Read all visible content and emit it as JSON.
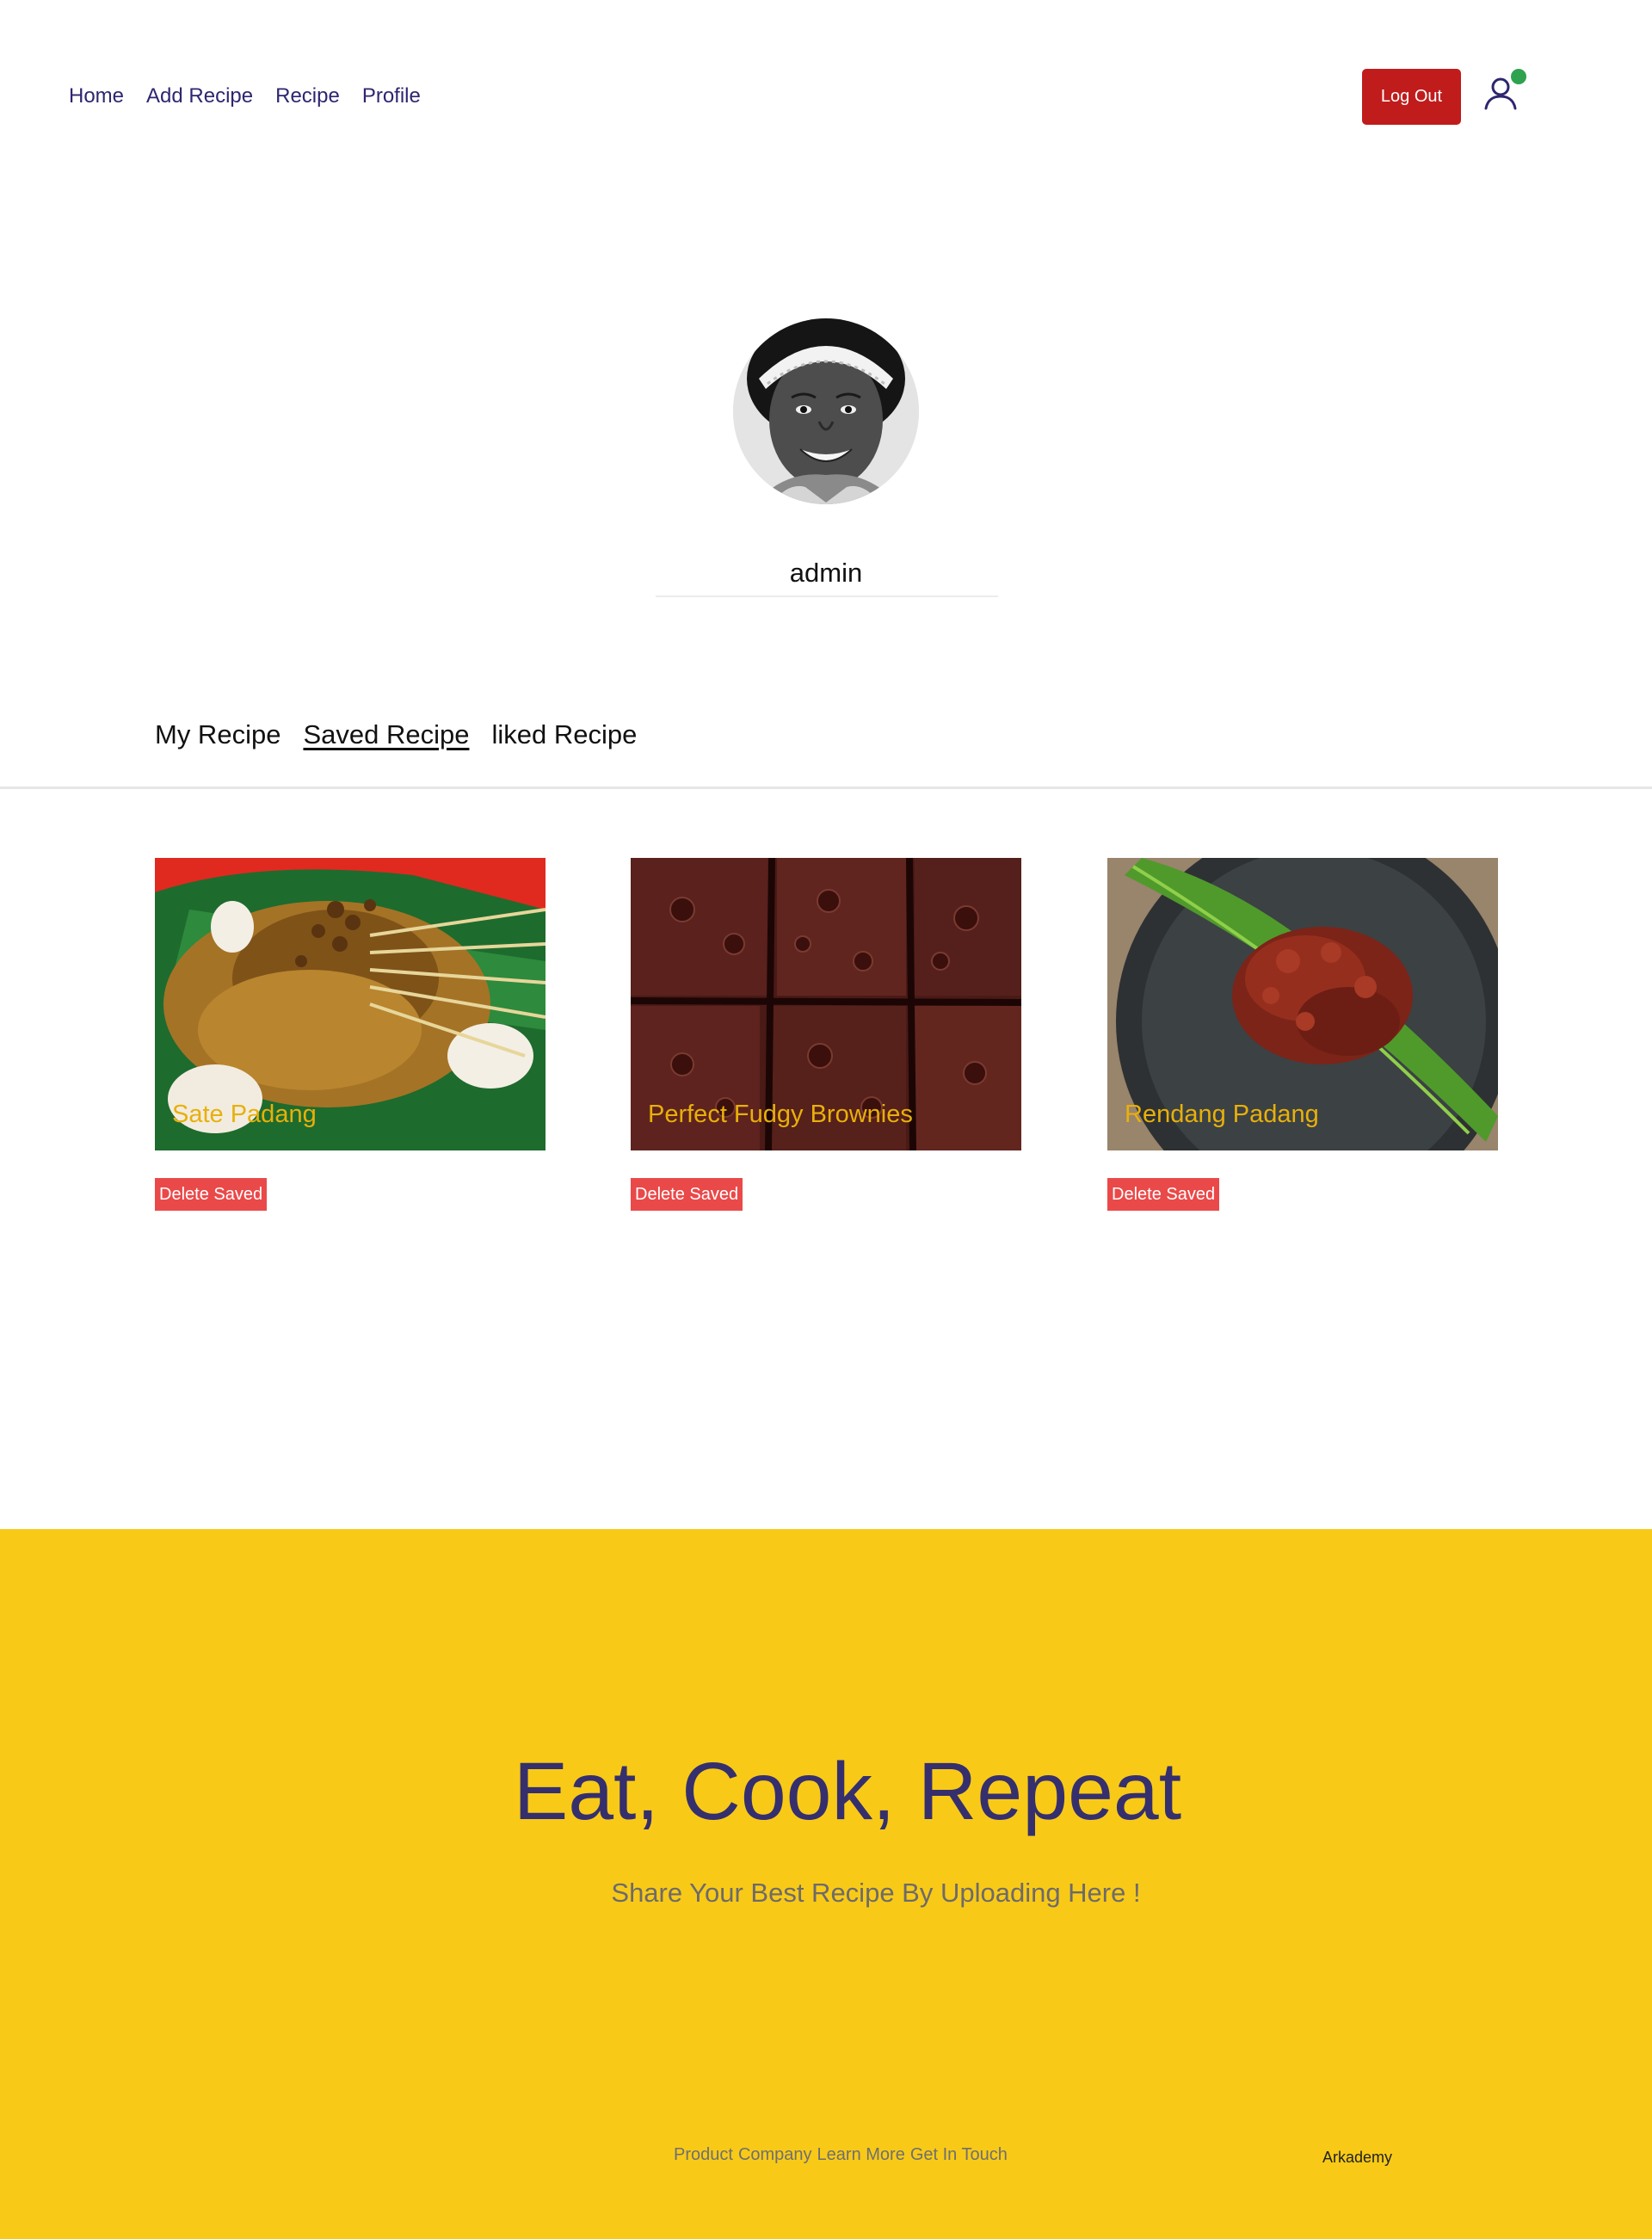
{
  "nav": {
    "links": [
      "Home",
      "Add Recipe",
      "Recipe",
      "Profile"
    ],
    "logout_label": "Log Out",
    "user_icon": "user-icon",
    "status_color": "#2ea24f"
  },
  "profile": {
    "username": "admin",
    "avatar": "profile-avatar-photo"
  },
  "tabs": {
    "items": [
      "My Recipe",
      "Saved Recipe",
      "liked Recipe"
    ],
    "active": "Saved Recipe"
  },
  "recipes": [
    {
      "title": "Sate Padang",
      "delete_label": "Delete Saved"
    },
    {
      "title": "Perfect Fudgy Brownies",
      "delete_label": "Delete Saved"
    },
    {
      "title": "Rendang Padang",
      "delete_label": "Delete Saved"
    }
  ],
  "footer": {
    "heading": "Eat, Cook, Repeat",
    "subheading": "Share Your Best Recipe By Uploading Here !",
    "links": [
      "Product",
      "Company",
      "Learn More",
      "Get In Touch"
    ],
    "brand": "Arkademy",
    "background_color": "#f8ca17"
  },
  "colors": {
    "nav_text": "#2e266f",
    "logout_button": "#c01c1c",
    "delete_button": "#ea4949",
    "recipe_title": "#e8b00a",
    "footer_heading": "#352f6e"
  }
}
